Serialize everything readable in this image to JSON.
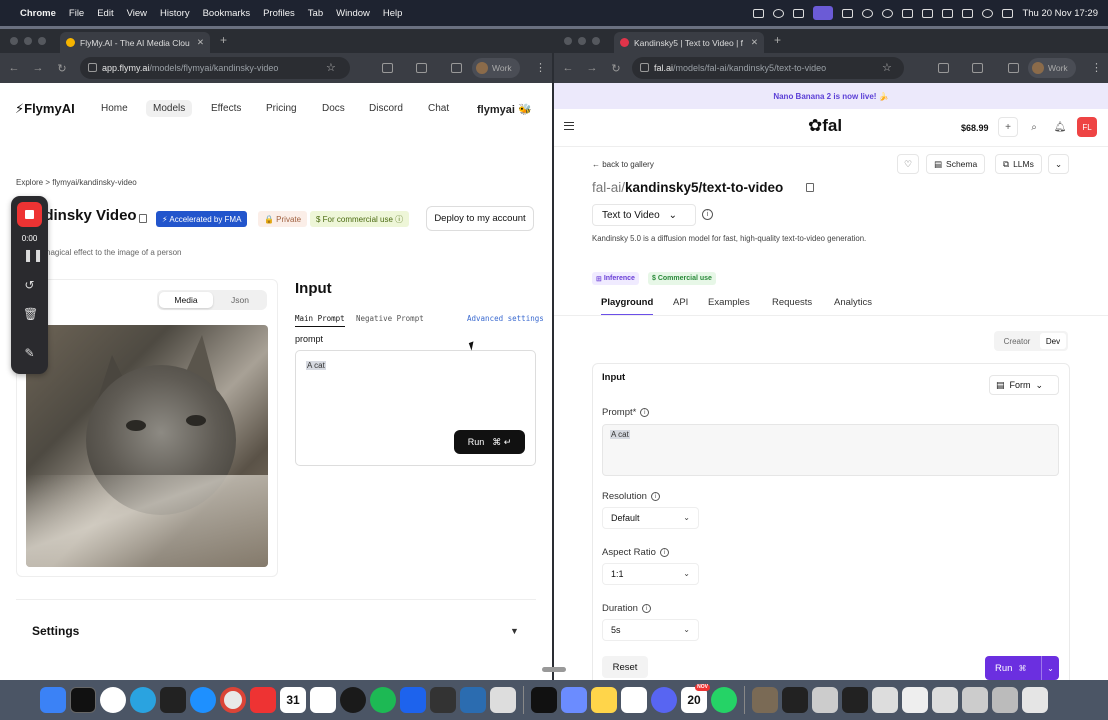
{
  "menubar": {
    "apple": "",
    "app": "Chrome",
    "items": [
      "File",
      "Edit",
      "View",
      "History",
      "Bookmarks",
      "Profiles",
      "Tab",
      "Window",
      "Help"
    ],
    "clock": "Thu 20 Nov  17:29"
  },
  "left_browser": {
    "tab_title": "FlyMy.AI - The AI Media Clou",
    "url_host": "app.flymy.ai",
    "url_path": "/models/flymyai/kandinsky-video",
    "profile": "Work"
  },
  "flymy": {
    "logo": "⚡FlymyAI",
    "nav": [
      "Home",
      "Models",
      "Effects",
      "Pricing",
      "Docs",
      "Discord",
      "Chat"
    ],
    "active_nav": "Models",
    "user": "flymyai",
    "breadcrumb": "Explore > flymyai/kandinsky-video",
    "title": "Kandinsky Video",
    "badges": {
      "fma": "⚡ Accelerated by FMA",
      "private": "🔒 Private",
      "commercial": "$ For commercial use  ⓘ"
    },
    "deploy_label": "Deploy to my account",
    "description": "nagical effect to the image of a person",
    "result": {
      "label": "ult",
      "tabs": [
        "Media",
        "Json"
      ],
      "active_tab": "Media"
    },
    "input": {
      "heading": "Input",
      "tabs": [
        "Main Prompt",
        "Negative Prompt"
      ],
      "advanced": "Advanced settings",
      "prompt_label": "prompt",
      "prompt_value": "A cat",
      "run_label": "Run",
      "run_kbd": "⌘ ↵"
    },
    "settings_label": "Settings"
  },
  "recorder": {
    "time": "0:00"
  },
  "right_browser": {
    "tab_title": "Kandinsky5 | Text to Video | f",
    "url_host": "fal.ai",
    "url_path": "/models/fal-ai/kandinsky5/text-to-video",
    "profile": "Work"
  },
  "fal": {
    "banner": "Nano Banana 2 is now live! 🍌",
    "logo": "fal",
    "credits": "$68.99",
    "avatar": "FL",
    "back": "back to gallery",
    "header_buttons": {
      "schema": "Schema",
      "llms": "LLMs"
    },
    "title_org": "fal-ai/",
    "title_name": "kandinsky5/text-to-video",
    "category": "Text to Video",
    "description": "Kandinsky 5.0 is a diffusion model for fast, high-quality text-to-video generation.",
    "badges": [
      "Inference",
      "Commercial use"
    ],
    "tabs": [
      "Playground",
      "API",
      "Examples",
      "Requests",
      "Analytics"
    ],
    "modes": [
      "Creator",
      "Dev"
    ],
    "active_mode": "Dev",
    "form": {
      "heading": "Input",
      "mode": "Form",
      "prompt_label": "Prompt*",
      "prompt_value": "A cat",
      "resolution_label": "Resolution",
      "resolution_value": "Default",
      "aspect_label": "Aspect Ratio",
      "aspect_value": "1:1",
      "duration_label": "Duration",
      "duration_value": "5s",
      "reset": "Reset",
      "run": "Run",
      "run_kbd": "⌘"
    }
  },
  "dock": {
    "calendar_month": "NOV",
    "calendar_day": "20"
  },
  "colors": {
    "fal_accent": "#6b2fe0",
    "fma_blue": "#2255cc",
    "record_red": "#e33333"
  }
}
